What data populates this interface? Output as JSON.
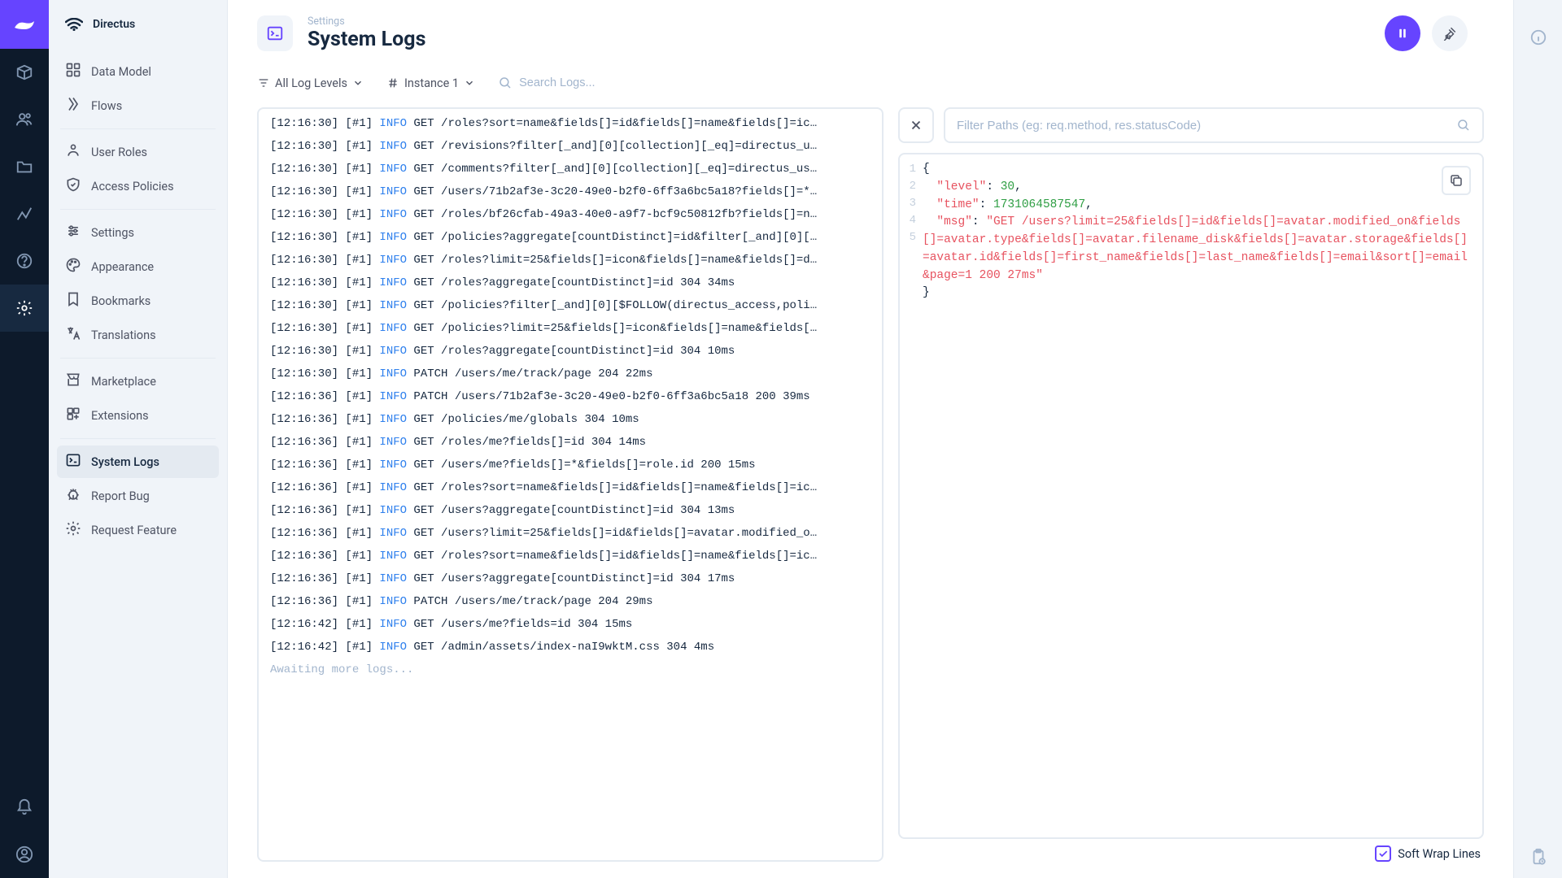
{
  "app_name": "Directus",
  "breadcrumb": "Settings",
  "page_title": "System Logs",
  "toolbar": {
    "log_levels": "All Log Levels",
    "instance": "Instance 1",
    "search_placeholder": "Search Logs..."
  },
  "sidebar": {
    "items": [
      {
        "label": "Data Model",
        "icon": "data-model"
      },
      {
        "label": "Flows",
        "icon": "flows"
      }
    ],
    "group2": [
      {
        "label": "User Roles",
        "icon": "user-roles"
      },
      {
        "label": "Access Policies",
        "icon": "access-policies"
      }
    ],
    "group3": [
      {
        "label": "Settings",
        "icon": "settings"
      },
      {
        "label": "Appearance",
        "icon": "appearance"
      },
      {
        "label": "Bookmarks",
        "icon": "bookmarks"
      },
      {
        "label": "Translations",
        "icon": "translations"
      }
    ],
    "group4": [
      {
        "label": "Marketplace",
        "icon": "marketplace"
      },
      {
        "label": "Extensions",
        "icon": "extensions"
      }
    ],
    "group5": [
      {
        "label": "System Logs",
        "icon": "system-logs",
        "active": true
      },
      {
        "label": "Report Bug",
        "icon": "report-bug"
      },
      {
        "label": "Request Feature",
        "icon": "request-feature"
      }
    ]
  },
  "logs": [
    {
      "time": "[12:16:30]",
      "inst": "[#1]",
      "level": "INFO",
      "msg": "GET /roles?sort=name&fields[]=id&fields[]=name&fields[]=ic…"
    },
    {
      "time": "[12:16:30]",
      "inst": "[#1]",
      "level": "INFO",
      "msg": "GET /revisions?filter[_and][0][collection][_eq]=directus_u…"
    },
    {
      "time": "[12:16:30]",
      "inst": "[#1]",
      "level": "INFO",
      "msg": "GET /comments?filter[_and][0][collection][_eq]=directus_us…"
    },
    {
      "time": "[12:16:30]",
      "inst": "[#1]",
      "level": "INFO",
      "msg": "GET /users/71b2af3e-3c20-49e0-b2f0-6ff3a6bc5a18?fields[]=*…"
    },
    {
      "time": "[12:16:30]",
      "inst": "[#1]",
      "level": "INFO",
      "msg": "GET /roles/bf26cfab-49a3-40e0-a9f7-bcf9c50812fb?fields[]=n…"
    },
    {
      "time": "[12:16:30]",
      "inst": "[#1]",
      "level": "INFO",
      "msg": "GET /policies?aggregate[countDistinct]=id&filter[_and][0][…"
    },
    {
      "time": "[12:16:30]",
      "inst": "[#1]",
      "level": "INFO",
      "msg": "GET /roles?limit=25&fields[]=icon&fields[]=name&fields[]=d…"
    },
    {
      "time": "[12:16:30]",
      "inst": "[#1]",
      "level": "INFO",
      "msg": "GET /roles?aggregate[countDistinct]=id 304 34ms"
    },
    {
      "time": "[12:16:30]",
      "inst": "[#1]",
      "level": "INFO",
      "msg": "GET /policies?filter[_and][0][$FOLLOW(directus_access,poli…"
    },
    {
      "time": "[12:16:30]",
      "inst": "[#1]",
      "level": "INFO",
      "msg": "GET /policies?limit=25&fields[]=icon&fields[]=name&fields[…"
    },
    {
      "time": "[12:16:30]",
      "inst": "[#1]",
      "level": "INFO",
      "msg": "GET /roles?aggregate[countDistinct]=id 304 10ms"
    },
    {
      "time": "[12:16:30]",
      "inst": "[#1]",
      "level": "INFO",
      "msg": "PATCH /users/me/track/page 204 22ms"
    },
    {
      "time": "[12:16:36]",
      "inst": "[#1]",
      "level": "INFO",
      "msg": "PATCH /users/71b2af3e-3c20-49e0-b2f0-6ff3a6bc5a18 200 39ms"
    },
    {
      "time": "[12:16:36]",
      "inst": "[#1]",
      "level": "INFO",
      "msg": "GET /policies/me/globals 304 10ms"
    },
    {
      "time": "[12:16:36]",
      "inst": "[#1]",
      "level": "INFO",
      "msg": "GET /roles/me?fields[]=id 304 14ms"
    },
    {
      "time": "[12:16:36]",
      "inst": "[#1]",
      "level": "INFO",
      "msg": "GET /users/me?fields[]=*&fields[]=role.id 200 15ms"
    },
    {
      "time": "[12:16:36]",
      "inst": "[#1]",
      "level": "INFO",
      "msg": "GET /roles?sort=name&fields[]=id&fields[]=name&fields[]=ic…"
    },
    {
      "time": "[12:16:36]",
      "inst": "[#1]",
      "level": "INFO",
      "msg": "GET /users?aggregate[countDistinct]=id 304 13ms"
    },
    {
      "time": "[12:16:36]",
      "inst": "[#1]",
      "level": "INFO",
      "msg": "GET /users?limit=25&fields[]=id&fields[]=avatar.modified_o…"
    },
    {
      "time": "[12:16:36]",
      "inst": "[#1]",
      "level": "INFO",
      "msg": "GET /roles?sort=name&fields[]=id&fields[]=name&fields[]=ic…"
    },
    {
      "time": "[12:16:36]",
      "inst": "[#1]",
      "level": "INFO",
      "msg": "GET /users?aggregate[countDistinct]=id 304 17ms"
    },
    {
      "time": "[12:16:36]",
      "inst": "[#1]",
      "level": "INFO",
      "msg": "PATCH /users/me/track/page 204 29ms"
    },
    {
      "time": "[12:16:42]",
      "inst": "[#1]",
      "level": "INFO",
      "msg": "GET /users/me?fields=id 304 15ms"
    },
    {
      "time": "[12:16:42]",
      "inst": "[#1]",
      "level": "INFO",
      "msg": "GET /admin/assets/index-naI9wktM.css 304 4ms"
    }
  ],
  "log_waiting": "Awaiting more logs...",
  "detail": {
    "filter_placeholder": "Filter Paths (eg: req.method, res.statusCode)",
    "json": {
      "level_key": "\"level\"",
      "level_val": "30",
      "time_key": "\"time\"",
      "time_val": "1731064587547",
      "msg_key": "\"msg\"",
      "msg_val": "\"GET /users?limit=25&fields[]=id&fields[]=avatar.modified_on&fields[]=avatar.type&fields[]=avatar.filename_disk&fields[]=avatar.storage&fields[]=avatar.id&fields[]=first_name&fields[]=last_name&fields[]=email&sort[]=email&page=1 200 27ms\"",
      "line1": "1",
      "line2": "2",
      "line3": "3",
      "line4": "4",
      "line5": "5"
    },
    "soft_wrap_label": "Soft Wrap Lines"
  }
}
